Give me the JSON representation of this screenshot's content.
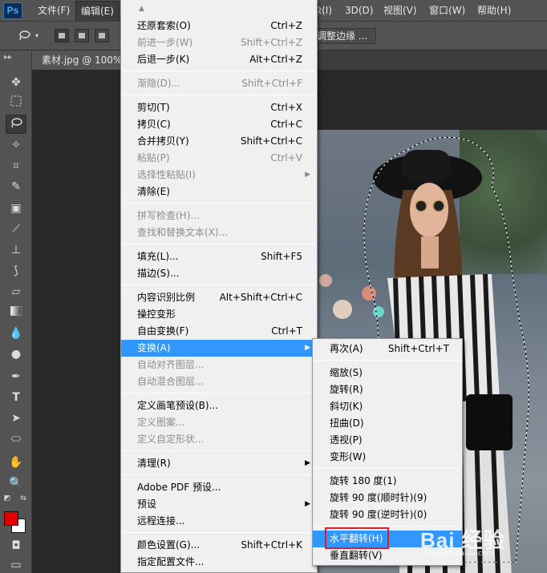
{
  "app": {
    "logo": "Ps"
  },
  "menubar": {
    "items": [
      {
        "label": "文件(F)"
      },
      {
        "label": "编辑(E)"
      },
      {
        "label": "图像(I)"
      },
      {
        "label": "3D(D)"
      },
      {
        "label": "视图(V)"
      },
      {
        "label": "窗口(W)"
      },
      {
        "label": "帮助(H)"
      }
    ]
  },
  "options_bar": {
    "refine_edge": "调整边缘 ..."
  },
  "document": {
    "tab_title": "素材.jpg @ 100%"
  },
  "edit_menu": {
    "items": [
      {
        "label": "还原套索(O)",
        "shortcut": "Ctrl+Z",
        "disabled": false
      },
      {
        "label": "前进一步(W)",
        "shortcut": "Shift+Ctrl+Z",
        "disabled": true
      },
      {
        "label": "后退一步(K)",
        "shortcut": "Alt+Ctrl+Z",
        "disabled": false
      },
      {
        "label": "渐隐(D)...",
        "shortcut": "Shift+Ctrl+F",
        "disabled": true
      },
      {
        "label": "剪切(T)",
        "shortcut": "Ctrl+X",
        "disabled": false
      },
      {
        "label": "拷贝(C)",
        "shortcut": "Ctrl+C",
        "disabled": false
      },
      {
        "label": "合并拷贝(Y)",
        "shortcut": "Shift+Ctrl+C",
        "disabled": false
      },
      {
        "label": "粘贴(P)",
        "shortcut": "Ctrl+V",
        "disabled": true
      },
      {
        "label": "选择性粘贴(I)",
        "shortcut": "",
        "disabled": true
      },
      {
        "label": "清除(E)",
        "shortcut": "",
        "disabled": false
      },
      {
        "label": "拼写检查(H)...",
        "shortcut": "",
        "disabled": true
      },
      {
        "label": "查找和替换文本(X)...",
        "shortcut": "",
        "disabled": true
      },
      {
        "label": "填充(L)...",
        "shortcut": "Shift+F5",
        "disabled": false
      },
      {
        "label": "描边(S)...",
        "shortcut": "",
        "disabled": false
      },
      {
        "label": "内容识别比例",
        "shortcut": "Alt+Shift+Ctrl+C",
        "disabled": false
      },
      {
        "label": "操控变形",
        "shortcut": "",
        "disabled": false
      },
      {
        "label": "自由变换(F)",
        "shortcut": "Ctrl+T",
        "disabled": false
      },
      {
        "label": "变换(A)",
        "shortcut": "",
        "disabled": false
      },
      {
        "label": "自动对齐图层...",
        "shortcut": "",
        "disabled": true
      },
      {
        "label": "自动混合图层...",
        "shortcut": "",
        "disabled": true
      },
      {
        "label": "定义画笔预设(B)...",
        "shortcut": "",
        "disabled": false
      },
      {
        "label": "定义图案...",
        "shortcut": "",
        "disabled": true
      },
      {
        "label": "定义自定形状...",
        "shortcut": "",
        "disabled": true
      },
      {
        "label": "清理(R)",
        "shortcut": "",
        "disabled": false
      },
      {
        "label": "Adobe PDF 预设...",
        "shortcut": "",
        "disabled": false
      },
      {
        "label": "预设",
        "shortcut": "",
        "disabled": false
      },
      {
        "label": "远程连接...",
        "shortcut": "",
        "disabled": false
      },
      {
        "label": "颜色设置(G)...",
        "shortcut": "Shift+Ctrl+K",
        "disabled": false
      },
      {
        "label": "指定配置文件...",
        "shortcut": "",
        "disabled": false
      }
    ]
  },
  "transform_menu": {
    "items": [
      {
        "label": "再次(A)",
        "shortcut": "Shift+Ctrl+T"
      },
      {
        "label": "缩放(S)",
        "shortcut": ""
      },
      {
        "label": "旋转(R)",
        "shortcut": ""
      },
      {
        "label": "斜切(K)",
        "shortcut": ""
      },
      {
        "label": "扭曲(D)",
        "shortcut": ""
      },
      {
        "label": "透视(P)",
        "shortcut": ""
      },
      {
        "label": "变形(W)",
        "shortcut": ""
      },
      {
        "label": "旋转 180 度(1)",
        "shortcut": ""
      },
      {
        "label": "旋转 90 度(顺时针)(9)",
        "shortcut": ""
      },
      {
        "label": "旋转 90 度(逆时针)(0)",
        "shortcut": ""
      },
      {
        "label": "水平翻转(H)",
        "shortcut": ""
      },
      {
        "label": "垂直翻转(V)",
        "shortcut": ""
      }
    ]
  },
  "colors": {
    "foreground": "#e30000",
    "background": "#ffffff",
    "menu_highlight": "#3297fd",
    "annotation_box": "#e31d28"
  },
  "watermark": {
    "text": "Bai 经验",
    "url": "jingyan.baidu.com"
  }
}
